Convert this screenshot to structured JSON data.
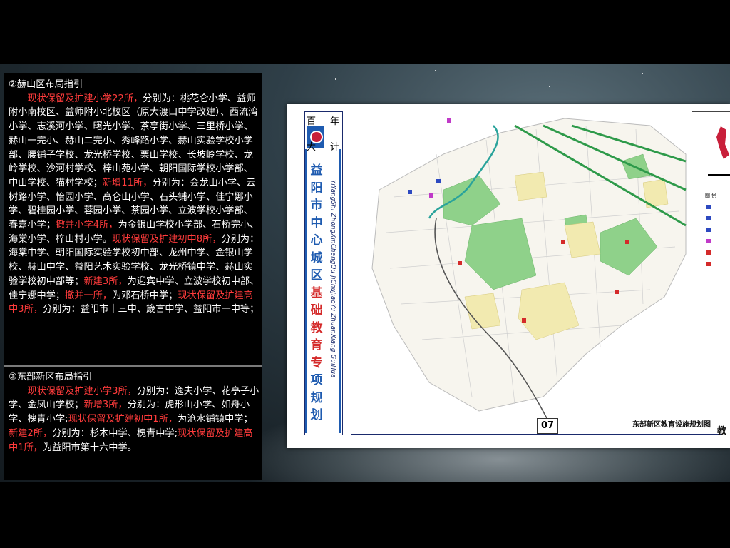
{
  "section_hesh": {
    "heading": "②赫山区布局指引",
    "runs": [
      {
        "t": "现状保留及扩建小学22所，",
        "red": true
      },
      {
        "t": "分别为：桃花仑小学、益师附小南校区、益师附小北校区（原大渡口中学改建）、西流湾小学、志溪河小学、曙光小学、茶亭街小学、三里桥小学、赫山一完小、赫山二完小、秀峰路小学、赫山实验学校小学部、腰铺子学校、龙光桥学校、栗山学校、长坡岭学校、龙岭学校、沙河村学校、梓山苑小学、朝阳国际学校小学部、中山学校、猫村学校；",
        "red": false
      },
      {
        "t": "新增11所，",
        "red": true
      },
      {
        "t": "分别为：会龙山小学、云树路小学、怡园小学、高仑山小学、石头铺小学、佳宁娜小学、碧桂园小学、蓉园小学、茶园小学、立波学校小学部、春嘉小学；",
        "red": false
      },
      {
        "t": "撤并小学4所，",
        "red": true
      },
      {
        "t": "为金银山学校小学部、石桥完小、海棠小学、梓山村小学。",
        "red": false
      },
      {
        "t": "现状保留及扩建初中8所，",
        "red": true
      },
      {
        "t": "分别为：海棠中学、朝阳国际实验学校初中部、龙州中学、金银山学校、赫山中学、益阳艺术实验学校、龙光桥镇中学、赫山实验学校初中部等；",
        "red": false
      },
      {
        "t": "新建3所，",
        "red": true
      },
      {
        "t": "为迎宾中学、立波学校初中部、佳宁娜中学；",
        "red": false
      },
      {
        "t": "撤并一所，",
        "red": true
      },
      {
        "t": "为邓石桥中学；",
        "red": false
      },
      {
        "t": "现状保留及扩建高中3所，",
        "red": true
      },
      {
        "t": "分别为：益阳市十三中、箴言中学、益阳市一中等；",
        "red": false
      }
    ]
  },
  "section_east": {
    "heading": "③东部新区布局指引",
    "runs": [
      {
        "t": "现状保留及扩建小学3所，",
        "red": true
      },
      {
        "t": "分别为：逸夫小学、花亭子小学、金凤山学校；",
        "red": false
      },
      {
        "t": "新增3所，",
        "red": true
      },
      {
        "t": "分别为：虎形山小学、如舟小学、槐青小学;",
        "red": false
      },
      {
        "t": "现状保留及扩建初中1所，",
        "red": true
      },
      {
        "t": "为沧水铺镇中学；",
        "red": false
      },
      {
        "t": "新建2所，",
        "red": true
      },
      {
        "t": "分别为：杉木中学、槐青中学;",
        "red": false
      },
      {
        "t": "现状保留及扩建高中1所，",
        "red": true
      },
      {
        "t": "为益阳市第十六中学。",
        "red": false
      }
    ]
  },
  "map": {
    "corner_tl": "百",
    "corner_tr": "年",
    "corner_bl": "大",
    "corner_br": "计",
    "title_chars": [
      "益",
      "阳",
      "市",
      "中",
      "心",
      "城",
      "区",
      "基",
      "础",
      "教",
      "育",
      "专",
      "项",
      "规",
      "划"
    ],
    "title_red_from": 7,
    "title_red_to": 11,
    "pinyin": "YiYangShi ZhongXinChengQu JiChuJiaoYu ZhuanXiang GuiHua",
    "page_number": "07",
    "caption": "东部新区教育设施规划图",
    "caption_right": "教",
    "legend_title": "图 例",
    "colors": {
      "red_text": "#ff3b3b",
      "map_green": "#8fd18a",
      "map_yellow": "#f2eab0",
      "rail_green": "#2e9a4a",
      "river": "#2aa39b",
      "brand_blue": "#1e5bb0"
    }
  }
}
